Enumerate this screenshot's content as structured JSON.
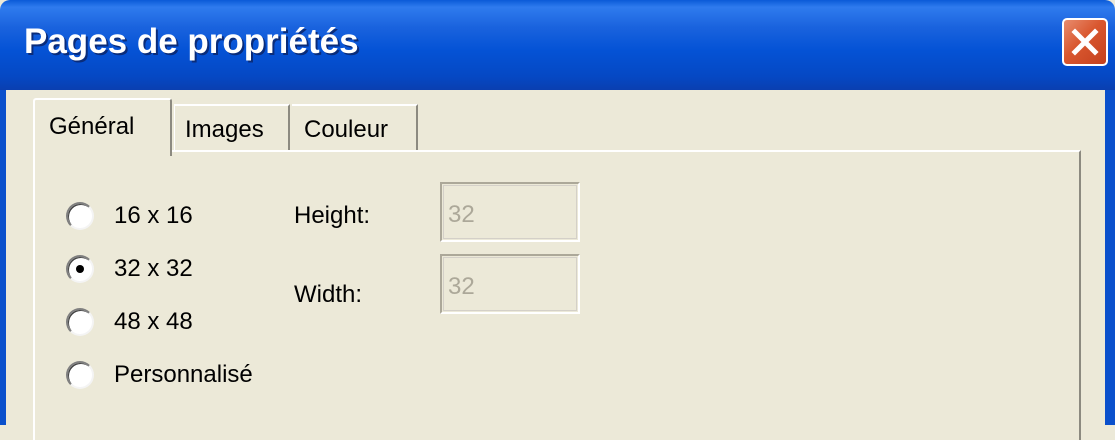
{
  "window": {
    "title": "Pages de propriétés",
    "close_icon": "close-icon"
  },
  "tabs": [
    {
      "label": "Général",
      "selected": true
    },
    {
      "label": "Images",
      "selected": false
    },
    {
      "label": "Couleur",
      "selected": false
    }
  ],
  "size_options": [
    {
      "label": "16 x 16",
      "selected": false
    },
    {
      "label": "32 x 32",
      "selected": true
    },
    {
      "label": "48 x 48",
      "selected": false
    },
    {
      "label": "Personnalisé",
      "selected": false
    }
  ],
  "fields": {
    "height": {
      "label": "Height:",
      "value": "32",
      "disabled": true
    },
    "width": {
      "label": "Width:",
      "value": "32",
      "disabled": true
    }
  },
  "colors": {
    "titlebar": "#0553D6",
    "close_button": "#D9572F",
    "dialog_background": "#ECE9D8",
    "disabled_text": "#ACA899"
  }
}
